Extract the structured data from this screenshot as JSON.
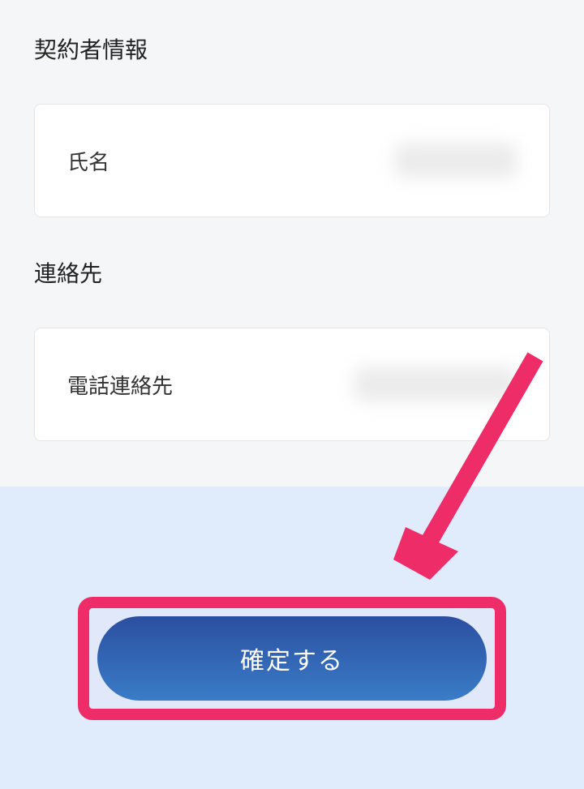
{
  "sections": {
    "contractor_info": {
      "title": "契約者情報",
      "name_label": "氏名"
    },
    "contact_info": {
      "title": "連絡先",
      "phone_label": "電話連絡先"
    }
  },
  "button": {
    "confirm_label": "確定する"
  },
  "colors": {
    "highlight": "#ed2c68",
    "button_gradient_start": "#2b4fa0",
    "button_gradient_end": "#3a7cc7",
    "lower_bg": "#e0ecfc"
  }
}
